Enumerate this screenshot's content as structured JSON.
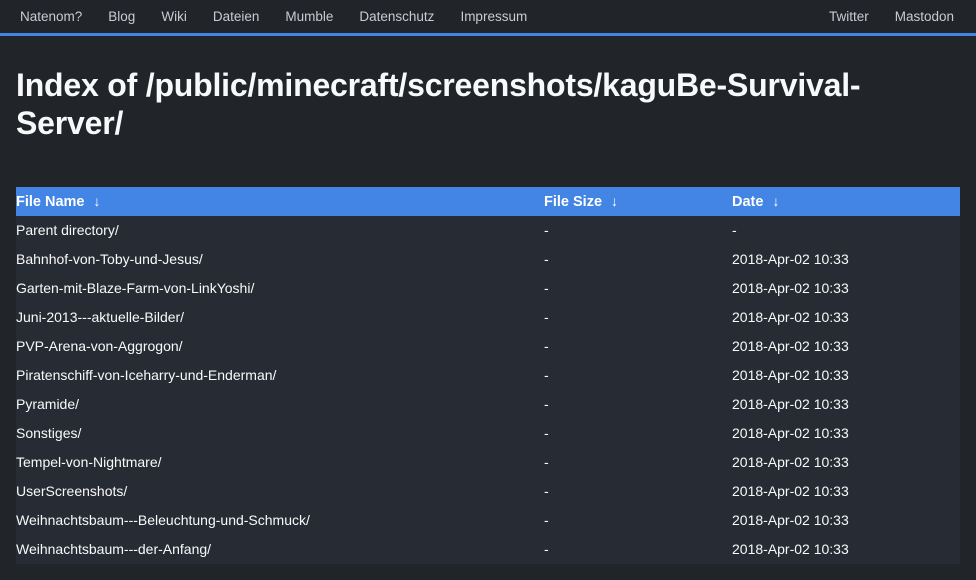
{
  "navbar": {
    "left_items": [
      {
        "label": "Natenom?",
        "name": "nav-item-natenom"
      },
      {
        "label": "Blog",
        "name": "nav-item-blog"
      },
      {
        "label": "Wiki",
        "name": "nav-item-wiki"
      },
      {
        "label": "Dateien",
        "name": "nav-item-dateien"
      },
      {
        "label": "Mumble",
        "name": "nav-item-mumble"
      },
      {
        "label": "Datenschutz",
        "name": "nav-item-datenschutz"
      },
      {
        "label": "Impressum",
        "name": "nav-item-impressum"
      }
    ],
    "right_items": [
      {
        "label": "Twitter",
        "name": "nav-item-twitter"
      },
      {
        "label": "Mastodon",
        "name": "nav-item-mastodon"
      }
    ],
    "accent_color": "#4285e4",
    "background_color": "#212529"
  },
  "page": {
    "title": "Index of /public/minecraft/screenshots/kaguBe-Survival-Server/",
    "background_color": "#212529",
    "text_color": "#f8f9fa"
  },
  "table": {
    "header_background": "#4285e4",
    "row_background": "#272b33",
    "sort_icon": "↓",
    "columns": [
      {
        "label": "File Name",
        "key": "name",
        "sortable": true
      },
      {
        "label": "File Size",
        "key": "size",
        "sortable": true
      },
      {
        "label": "Date",
        "key": "date",
        "sortable": true
      }
    ],
    "rows": [
      {
        "name": "Parent directory/",
        "size": "-",
        "date": "-"
      },
      {
        "name": "Bahnhof-von-Toby-und-Jesus/",
        "size": "-",
        "date": "2018-Apr-02 10:33"
      },
      {
        "name": "Garten-mit-Blaze-Farm-von-LinkYoshi/",
        "size": "-",
        "date": "2018-Apr-02 10:33"
      },
      {
        "name": "Juni-2013---aktuelle-Bilder/",
        "size": "-",
        "date": "2018-Apr-02 10:33"
      },
      {
        "name": "PVP-Arena-von-Aggrogon/",
        "size": "-",
        "date": "2018-Apr-02 10:33"
      },
      {
        "name": "Piratenschiff-von-Iceharry-und-Enderman/",
        "size": "-",
        "date": "2018-Apr-02 10:33"
      },
      {
        "name": "Pyramide/",
        "size": "-",
        "date": "2018-Apr-02 10:33"
      },
      {
        "name": "Sonstiges/",
        "size": "-",
        "date": "2018-Apr-02 10:33"
      },
      {
        "name": "Tempel-von-Nightmare/",
        "size": "-",
        "date": "2018-Apr-02 10:33"
      },
      {
        "name": "UserScreenshots/",
        "size": "-",
        "date": "2018-Apr-02 10:33"
      },
      {
        "name": "Weihnachtsbaum---Beleuchtung-und-Schmuck/",
        "size": "-",
        "date": "2018-Apr-02 10:33"
      },
      {
        "name": "Weihnachtsbaum---der-Anfang/",
        "size": "-",
        "date": "2018-Apr-02 10:33"
      }
    ]
  }
}
